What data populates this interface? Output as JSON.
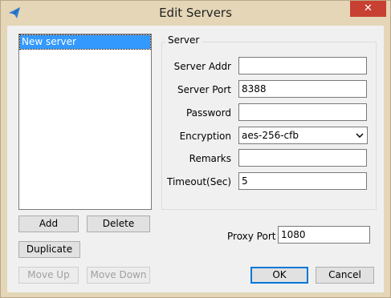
{
  "window": {
    "title": "Edit Servers",
    "close_glyph": "✕",
    "app_icon": "paper-plane-icon"
  },
  "servers": [
    {
      "label": "New server",
      "selected": true
    }
  ],
  "buttons": {
    "add": "Add",
    "delete": "Delete",
    "duplicate": "Duplicate",
    "move_up": "Move Up",
    "move_down": "Move Down",
    "ok": "OK",
    "cancel": "Cancel"
  },
  "server_group": {
    "title": "Server",
    "fields": {
      "server_addr": {
        "label": "Server Addr",
        "value": ""
      },
      "server_port": {
        "label": "Server Port",
        "value": "8388"
      },
      "password": {
        "label": "Password",
        "value": ""
      },
      "encryption": {
        "label": "Encryption",
        "value": "aes-256-cfb"
      },
      "remarks": {
        "label": "Remarks",
        "value": ""
      },
      "timeout": {
        "label": "Timeout(Sec)",
        "value": "5"
      }
    }
  },
  "proxy": {
    "label": "Proxy Port",
    "value": "1080"
  },
  "colors": {
    "title_bg": "#e4d6b6",
    "close_bg": "#c84031",
    "selection": "#3399ff",
    "accent": "#0078d7"
  }
}
